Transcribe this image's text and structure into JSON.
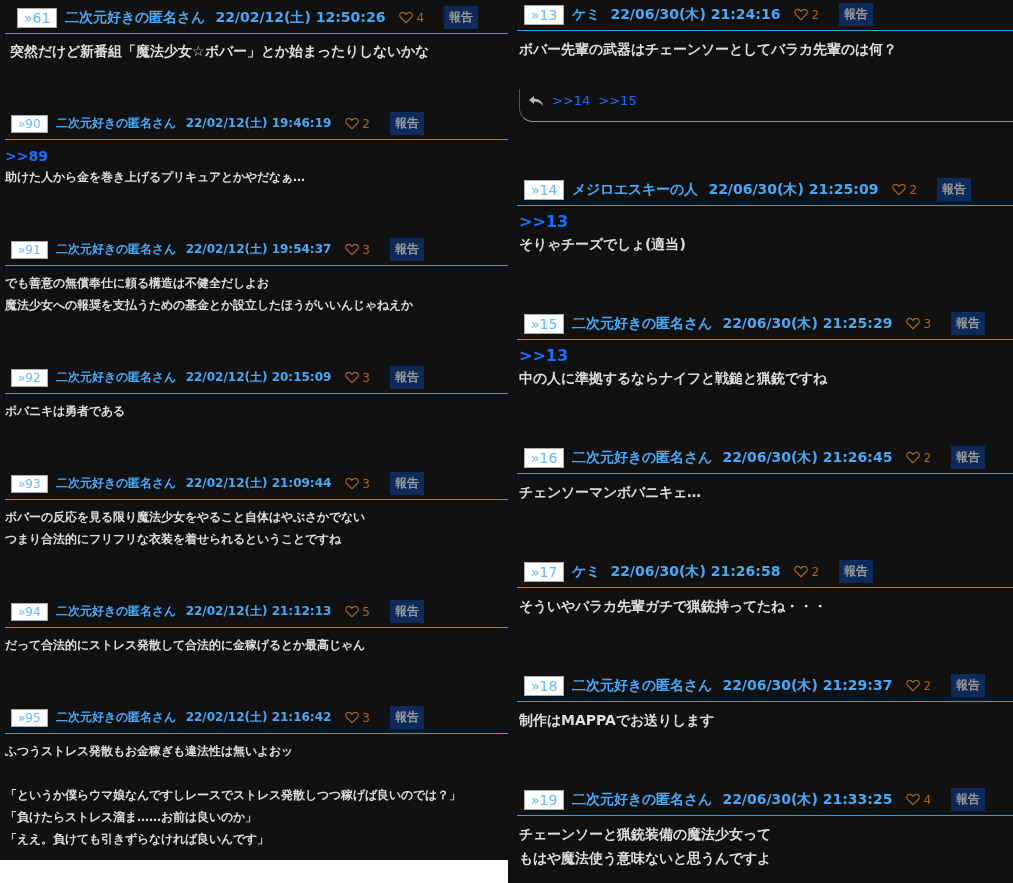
{
  "columns": [
    {
      "posts": [
        {
          "id": "»61",
          "name": "二次元好きの匿名さん",
          "date": "22/02/12(土) 12:50:26",
          "likes": "4",
          "report": "報告",
          "paragraphs": [
            "突然だけど新番組「魔法少女☆ボバー」とか始まったりしないかな"
          ]
        },
        {
          "id": "»90",
          "name": "二次元好きの匿名さん",
          "date": "22/02/12(土) 19:46:19",
          "likes": "2",
          "report": "報告",
          "anchor": ">>89",
          "paragraphs": [
            "助けた人から金を巻き上げるプリキュアとかやだなぁ…"
          ]
        },
        {
          "id": "»91",
          "name": "二次元好きの匿名さん",
          "date": "22/02/12(土) 19:54:37",
          "likes": "3",
          "report": "報告",
          "paragraphs": [
            "でも善意の無償奉仕に頼る構造は不健全だしよお",
            "魔法少女への報奨を支払うための基金とか設立したほうがいいんじゃねえか"
          ]
        },
        {
          "id": "»92",
          "name": "二次元好きの匿名さん",
          "date": "22/02/12(土) 20:15:09",
          "likes": "3",
          "report": "報告",
          "paragraphs": [
            "ボバニキは勇者である"
          ]
        },
        {
          "id": "»93",
          "name": "二次元好きの匿名さん",
          "date": "22/02/12(土) 21:09:44",
          "likes": "3",
          "report": "報告",
          "paragraphs": [
            "ボバーの反応を見る限り魔法少女をやること自体はやぶさかでない",
            "つまり合法的にフリフリな衣装を着せられるということですね"
          ]
        },
        {
          "id": "»94",
          "name": "二次元好きの匿名さん",
          "date": "22/02/12(土) 21:12:13",
          "likes": "5",
          "report": "報告",
          "paragraphs": [
            "だって合法的にストレス発散して合法的に金稼げるとか最高じゃん"
          ]
        },
        {
          "id": "»95",
          "name": "二次元好きの匿名さん",
          "date": "22/02/12(土) 21:16:42",
          "likes": "3",
          "report": "報告",
          "paragraphs": [
            "ふつうストレス発散もお金稼ぎも違法性は無いよおッ"
          ],
          "quotes": [
            "「というか僕らウマ娘なんですしレースでストレス発散しつつ稼げば良いのでは？」",
            "「負けたらストレス溜ま……お前は良いのか」",
            "「ええ。負けても引きずらなければ良いんです」"
          ]
        }
      ]
    },
    {
      "posts": [
        {
          "id": "»13",
          "name": "ケミ",
          "date": "22/06/30(木) 21:24:16",
          "likes": "2",
          "report": "報告",
          "paragraphs": [
            "ボバー先輩の武器はチェーンソーとしてバラカ先輩のは何？"
          ],
          "replies": [
            ">>14",
            ">>15"
          ]
        },
        {
          "id": "»14",
          "name": "メジロエスキーの人",
          "date": "22/06/30(木) 21:25:09",
          "likes": "2",
          "report": "報告",
          "anchor": ">>13",
          "paragraphs": [
            "そりゃチーズでしょ(適当)"
          ]
        },
        {
          "id": "»15",
          "name": "二次元好きの匿名さん",
          "date": "22/06/30(木) 21:25:29",
          "likes": "3",
          "report": "報告",
          "anchor": ">>13",
          "paragraphs": [
            "中の人に準拠するならナイフと戦鎚と猟銃ですね"
          ]
        },
        {
          "id": "»16",
          "name": "二次元好きの匿名さん",
          "date": "22/06/30(木) 21:26:45",
          "likes": "2",
          "report": "報告",
          "paragraphs": [
            "チェンソーマンボバニキェ…"
          ]
        },
        {
          "id": "»17",
          "name": "ケミ",
          "date": "22/06/30(木) 21:26:58",
          "likes": "2",
          "report": "報告",
          "paragraphs": [
            "そういやバラカ先輩ガチで猟銃持ってたね・・・"
          ]
        },
        {
          "id": "»18",
          "name": "二次元好きの匿名さん",
          "date": "22/06/30(木) 21:29:37",
          "likes": "2",
          "report": "報告",
          "paragraphs": [
            "制作はMAPPAでお送りします"
          ]
        },
        {
          "id": "»19",
          "name": "二次元好きの匿名さん",
          "date": "22/06/30(木) 21:33:25",
          "likes": "4",
          "report": "報告",
          "paragraphs": [
            "チェーンソーと猟銃装備の魔法少女って",
            "もはや魔法使う意味ないと思うんですよ"
          ]
        }
      ]
    }
  ]
}
